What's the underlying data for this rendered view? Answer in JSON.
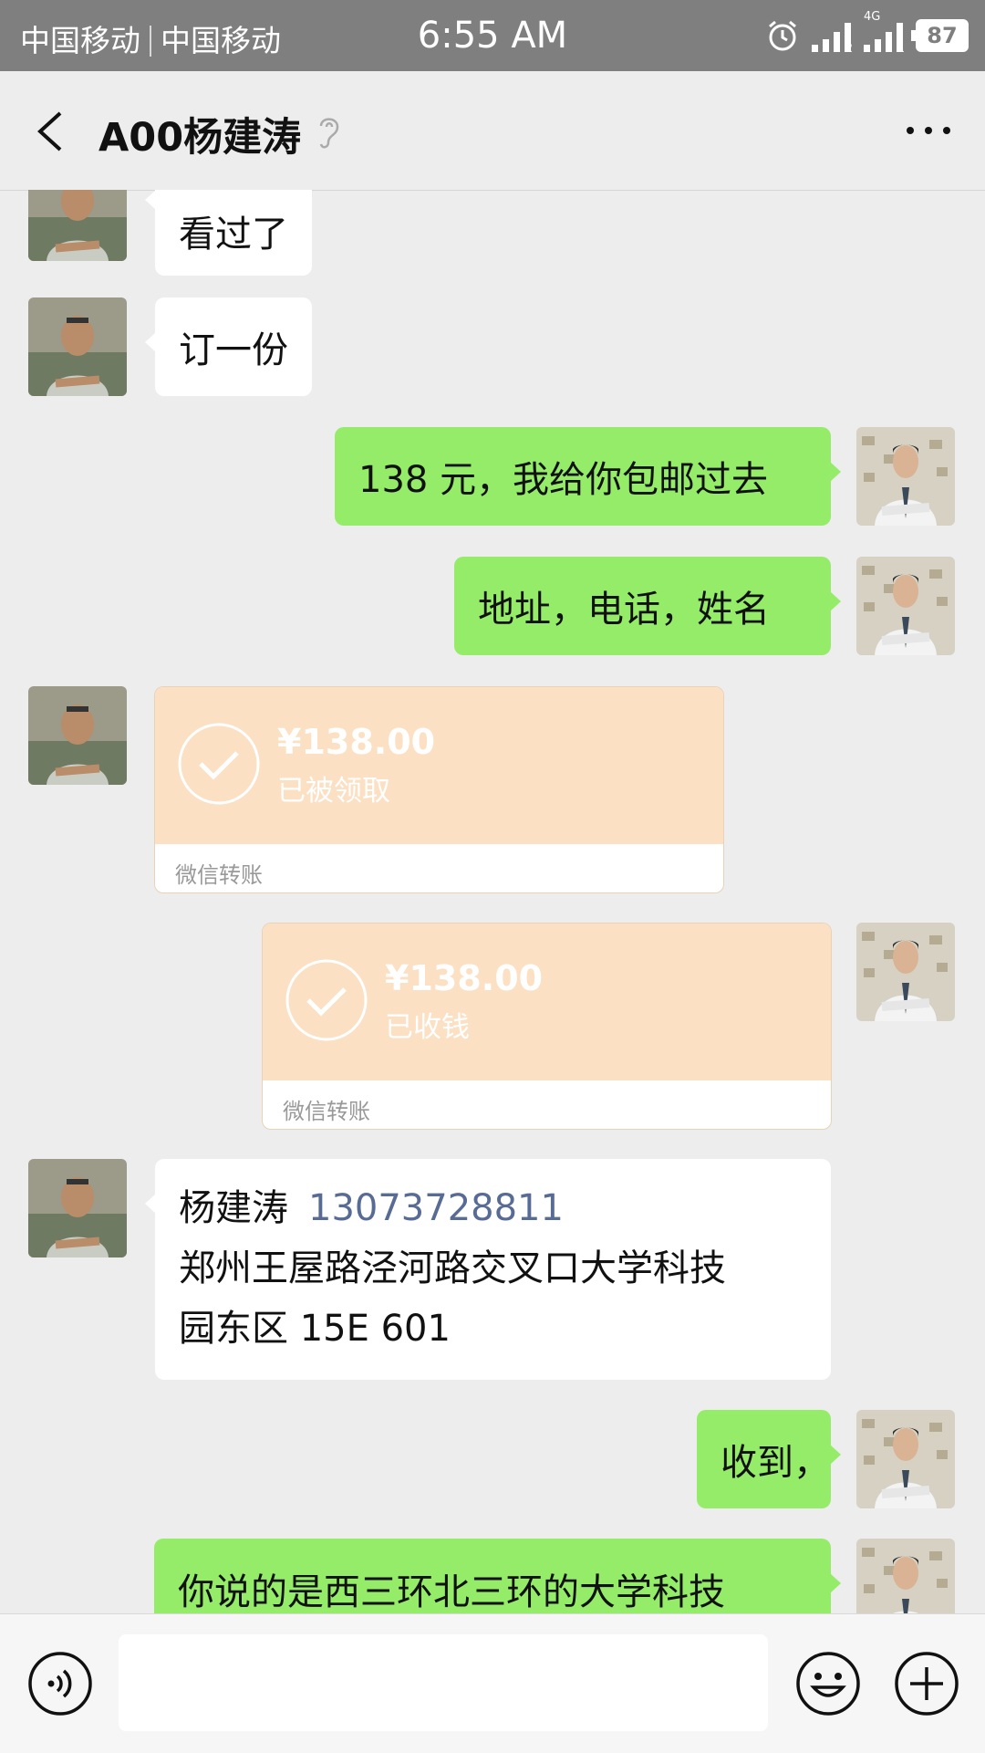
{
  "status_bar": {
    "carrier1": "中国移动",
    "carrier2": "中国移动",
    "time": "6:55 AM",
    "sim1": "2",
    "sim2": "1",
    "network": "4G",
    "battery": "87"
  },
  "header": {
    "title": "A00杨建涛"
  },
  "messages": {
    "m1": "看过了",
    "m2": "订一份",
    "m3": "138 元，我给你包邮过去",
    "m4": "地址，电话，姓名",
    "transfer1": {
      "amount": "¥138.00",
      "status": "已被领取",
      "footer": "微信转账"
    },
    "transfer2": {
      "amount": "¥138.00",
      "status": "已收钱",
      "footer": "微信转账"
    },
    "contact": {
      "name": "杨建涛",
      "phone": "13073728811",
      "line2": "郑州王屋路泾河路交叉口大学科技",
      "line3": "园东区 15E 601"
    },
    "m5": "收到，",
    "m6": "你说的是西三环北三环的大学科技"
  },
  "colors": {
    "sent_bubble": "#95ec69",
    "received_bubble": "#ffffff",
    "transfer_card": "#fce0c3",
    "link": "#576b95"
  }
}
